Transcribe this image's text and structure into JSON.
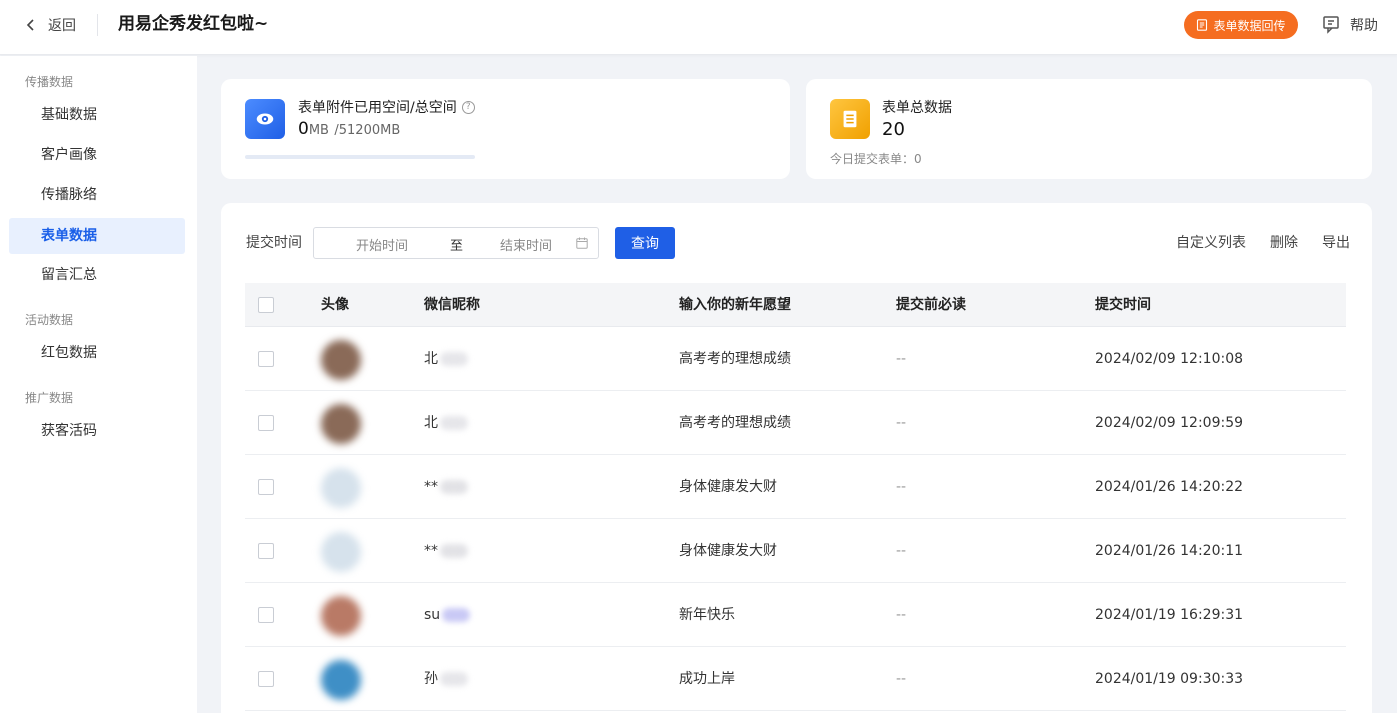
{
  "header": {
    "back_label": "返回",
    "title": "用易企秀发红包啦~",
    "feedback_button": "表单数据回传",
    "help_label": "帮助"
  },
  "sidebar": {
    "groups": [
      {
        "label": "传播数据",
        "items": [
          "基础数据",
          "客户画像",
          "传播脉络",
          "表单数据",
          "留言汇总"
        ]
      },
      {
        "label": "活动数据",
        "items": [
          "红包数据"
        ]
      },
      {
        "label": "推广数据",
        "items": [
          "获客活码"
        ]
      }
    ],
    "active_item": "表单数据"
  },
  "storage_card": {
    "label": "表单附件已用空间/总空间",
    "help_glyph": "?",
    "used": "0",
    "used_unit": "MB",
    "total": "/51200MB",
    "progress": 0
  },
  "total_card": {
    "label": "表单总数据",
    "value": "20",
    "today_label": "今日提交表单：",
    "today_value": "0"
  },
  "filter": {
    "label": "提交时间",
    "start_placeholder": "开始时间",
    "separator": "至",
    "end_placeholder": "结束时间",
    "query_button": "查询"
  },
  "actions": [
    "自定义列表",
    "删除",
    "导出"
  ],
  "table": {
    "columns": [
      "头像",
      "微信昵称",
      "输入你的新年愿望",
      "提交前必读",
      "提交时间"
    ],
    "rows": [
      {
        "avatar_color": "#8a6a58",
        "nickname": "北",
        "smear_color": "#e6e6ea",
        "wish": "高考考的理想成绩",
        "must_read": "--",
        "time": "2024/02/09 12:10:08"
      },
      {
        "avatar_color": "#8a6a58",
        "nickname": "北",
        "smear_color": "#e6e6ea",
        "wish": "高考考的理想成绩",
        "must_read": "--",
        "time": "2024/02/09 12:09:59"
      },
      {
        "avatar_color": "#d6e2ec",
        "nickname": "**",
        "smear_color": "#e2e2e6",
        "wish": "身体健康发大财",
        "must_read": "--",
        "time": "2024/01/26 14:20:22"
      },
      {
        "avatar_color": "#d6e2ec",
        "nickname": "**",
        "smear_color": "#e2e2e6",
        "wish": "身体健康发大财",
        "must_read": "--",
        "time": "2024/01/26 14:20:11"
      },
      {
        "avatar_color": "#b97a66",
        "nickname": "su",
        "smear_color": "#c9c9f5",
        "wish": "新年快乐",
        "must_read": "--",
        "time": "2024/01/19 16:29:31"
      },
      {
        "avatar_color": "#3f8fc6",
        "nickname": "孙",
        "smear_color": "#e6e6ea",
        "wish": "成功上岸",
        "must_read": "--",
        "time": "2024/01/19 09:30:33"
      }
    ]
  }
}
